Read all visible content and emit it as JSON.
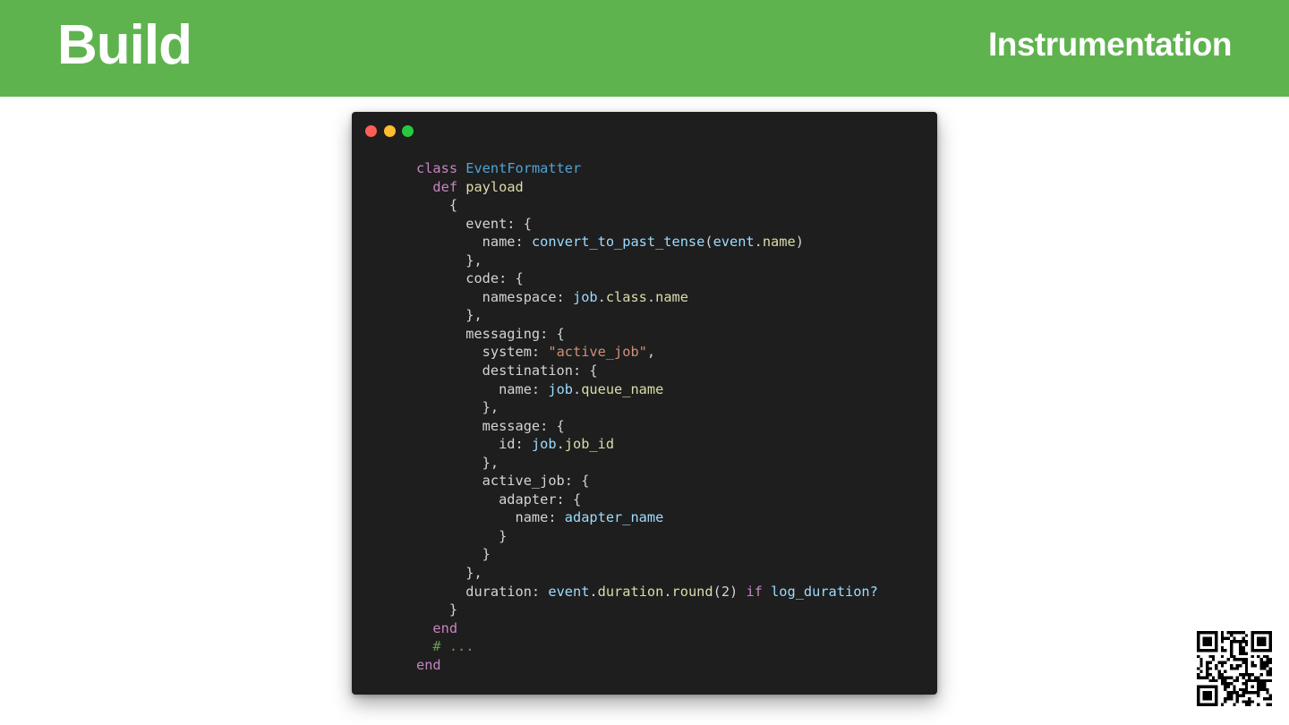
{
  "header": {
    "title": "Build",
    "section": "Instrumentation"
  },
  "colors": {
    "header_bg": "#5fb34e",
    "editor_bg": "#1e1e1e",
    "keyword": "#c586c0",
    "class_name": "#4fa3d6",
    "function": "#dcdcaa",
    "variable": "#9cdcfe",
    "string": "#ce9178",
    "comment": "#6a9955"
  },
  "window_controls": [
    "close-dot",
    "minimize-dot",
    "maximize-dot"
  ],
  "code_lines": [
    [
      {
        "t": "class ",
        "c": "kw"
      },
      {
        "t": "EventFormatter",
        "c": "cls"
      }
    ],
    [
      {
        "t": "  "
      },
      {
        "t": "def ",
        "c": "kw"
      },
      {
        "t": "payload",
        "c": "fn"
      }
    ],
    [
      {
        "t": "    {"
      }
    ],
    [
      {
        "t": "      event: {"
      }
    ],
    [
      {
        "t": "        name: "
      },
      {
        "t": "convert_to_past_tense",
        "c": "var"
      },
      {
        "t": "("
      },
      {
        "t": "event",
        "c": "var"
      },
      {
        "t": "."
      },
      {
        "t": "name",
        "c": "fn"
      },
      {
        "t": ")"
      }
    ],
    [
      {
        "t": "      },"
      }
    ],
    [
      {
        "t": "      code: {"
      }
    ],
    [
      {
        "t": "        namespace: "
      },
      {
        "t": "job",
        "c": "var"
      },
      {
        "t": "."
      },
      {
        "t": "class",
        "c": "fn"
      },
      {
        "t": "."
      },
      {
        "t": "name",
        "c": "fn"
      }
    ],
    [
      {
        "t": "      },"
      }
    ],
    [
      {
        "t": "      messaging: {"
      }
    ],
    [
      {
        "t": "        system: "
      },
      {
        "t": "\"active_job\"",
        "c": "str"
      },
      {
        "t": ","
      }
    ],
    [
      {
        "t": "        destination: {"
      }
    ],
    [
      {
        "t": "          name: "
      },
      {
        "t": "job",
        "c": "var"
      },
      {
        "t": "."
      },
      {
        "t": "queue_name",
        "c": "fn"
      }
    ],
    [
      {
        "t": "        },"
      }
    ],
    [
      {
        "t": "        message: {"
      }
    ],
    [
      {
        "t": "          id: "
      },
      {
        "t": "job",
        "c": "var"
      },
      {
        "t": "."
      },
      {
        "t": "job_id",
        "c": "fn"
      }
    ],
    [
      {
        "t": "        },"
      }
    ],
    [
      {
        "t": "        active_job: {"
      }
    ],
    [
      {
        "t": "          adapter: {"
      }
    ],
    [
      {
        "t": "            name: "
      },
      {
        "t": "adapter_name",
        "c": "var"
      }
    ],
    [
      {
        "t": "          }"
      }
    ],
    [
      {
        "t": "        }"
      }
    ],
    [
      {
        "t": "      },"
      }
    ],
    [
      {
        "t": "      duration: "
      },
      {
        "t": "event",
        "c": "var"
      },
      {
        "t": "."
      },
      {
        "t": "duration",
        "c": "fn"
      },
      {
        "t": "."
      },
      {
        "t": "round",
        "c": "fn"
      },
      {
        "t": "(2) "
      },
      {
        "t": "if ",
        "c": "kw"
      },
      {
        "t": "log_duration?",
        "c": "var"
      }
    ],
    [
      {
        "t": "    }"
      }
    ],
    [
      {
        "t": "  "
      },
      {
        "t": "end",
        "c": "kw"
      }
    ],
    [
      {
        "t": "  "
      },
      {
        "t": "# ...",
        "c": "cmt"
      }
    ],
    [
      {
        "t": "end",
        "c": "kw"
      }
    ]
  ]
}
